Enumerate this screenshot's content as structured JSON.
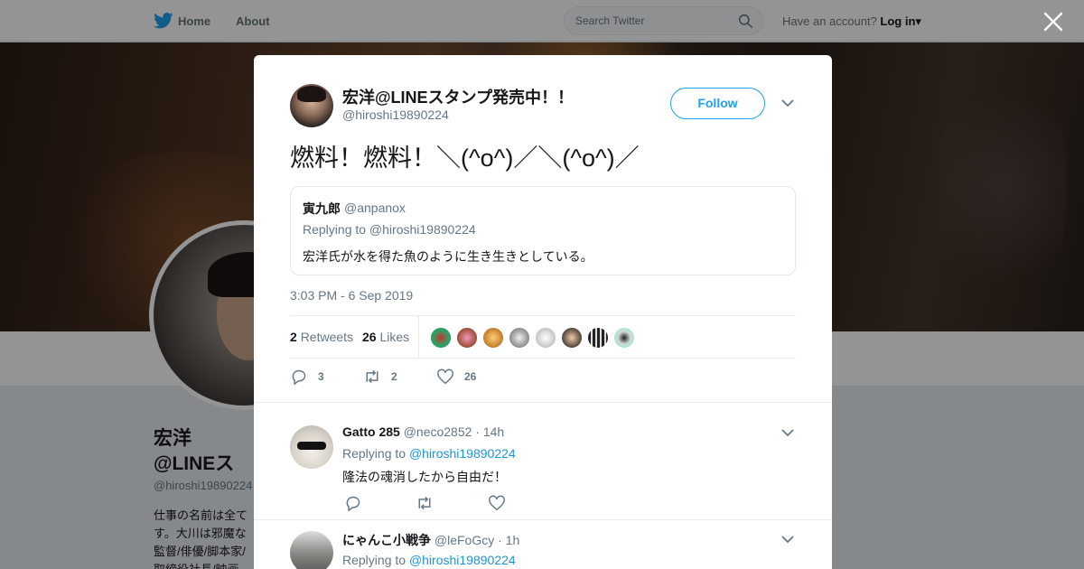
{
  "nav": {
    "home": "Home",
    "about": "About",
    "search_placeholder": "Search Twitter",
    "have_account": "Have an account?",
    "login": "Log in"
  },
  "profile": {
    "name": "宏洋@LINEスタンプ発売中！！",
    "handle": "@hiroshi19890224",
    "bio": "仕事の名前は全てす。大川は邪魔な監督/俳優/脚本家/取締役社長/映画"
  },
  "tweet": {
    "author_name": "宏洋@LINEスタンプ発売中！！",
    "author_handle": "@hiroshi19890224",
    "follow_label": "Follow",
    "text": "燃料！燃料！＼(^o^)／＼(^o^)／",
    "quote": {
      "name": "寅九郎",
      "handle": "@anpanox",
      "replying": "Replying to @hiroshi19890224",
      "text": "宏洋氏が水を得た魚のように生き生きとしている。"
    },
    "timestamp": "3:03 PM - 6 Sep 2019",
    "retweets_count": "2",
    "retweets_label": "Retweets",
    "likes_count": "26",
    "likes_label": "Likes",
    "reply_count": "3",
    "retweet_count_action": "2",
    "like_count_action": "26"
  },
  "replies": [
    {
      "name": "Gatto 285",
      "handle": "@neco2852",
      "time": "· 14h",
      "replying_prefix": "Replying to",
      "replying_to": "@hiroshi19890224",
      "text": "隆法の魂消したから自由だ！"
    },
    {
      "name": "にゃんこ小戦争",
      "handle": "@leFoGcy",
      "time": "· 1h",
      "replying_prefix": "Replying to",
      "replying_to": "@hiroshi19890224",
      "text": ""
    }
  ],
  "colors": {
    "accent": "#1da1f2",
    "link": "#1b95e0",
    "muted": "#657786"
  }
}
